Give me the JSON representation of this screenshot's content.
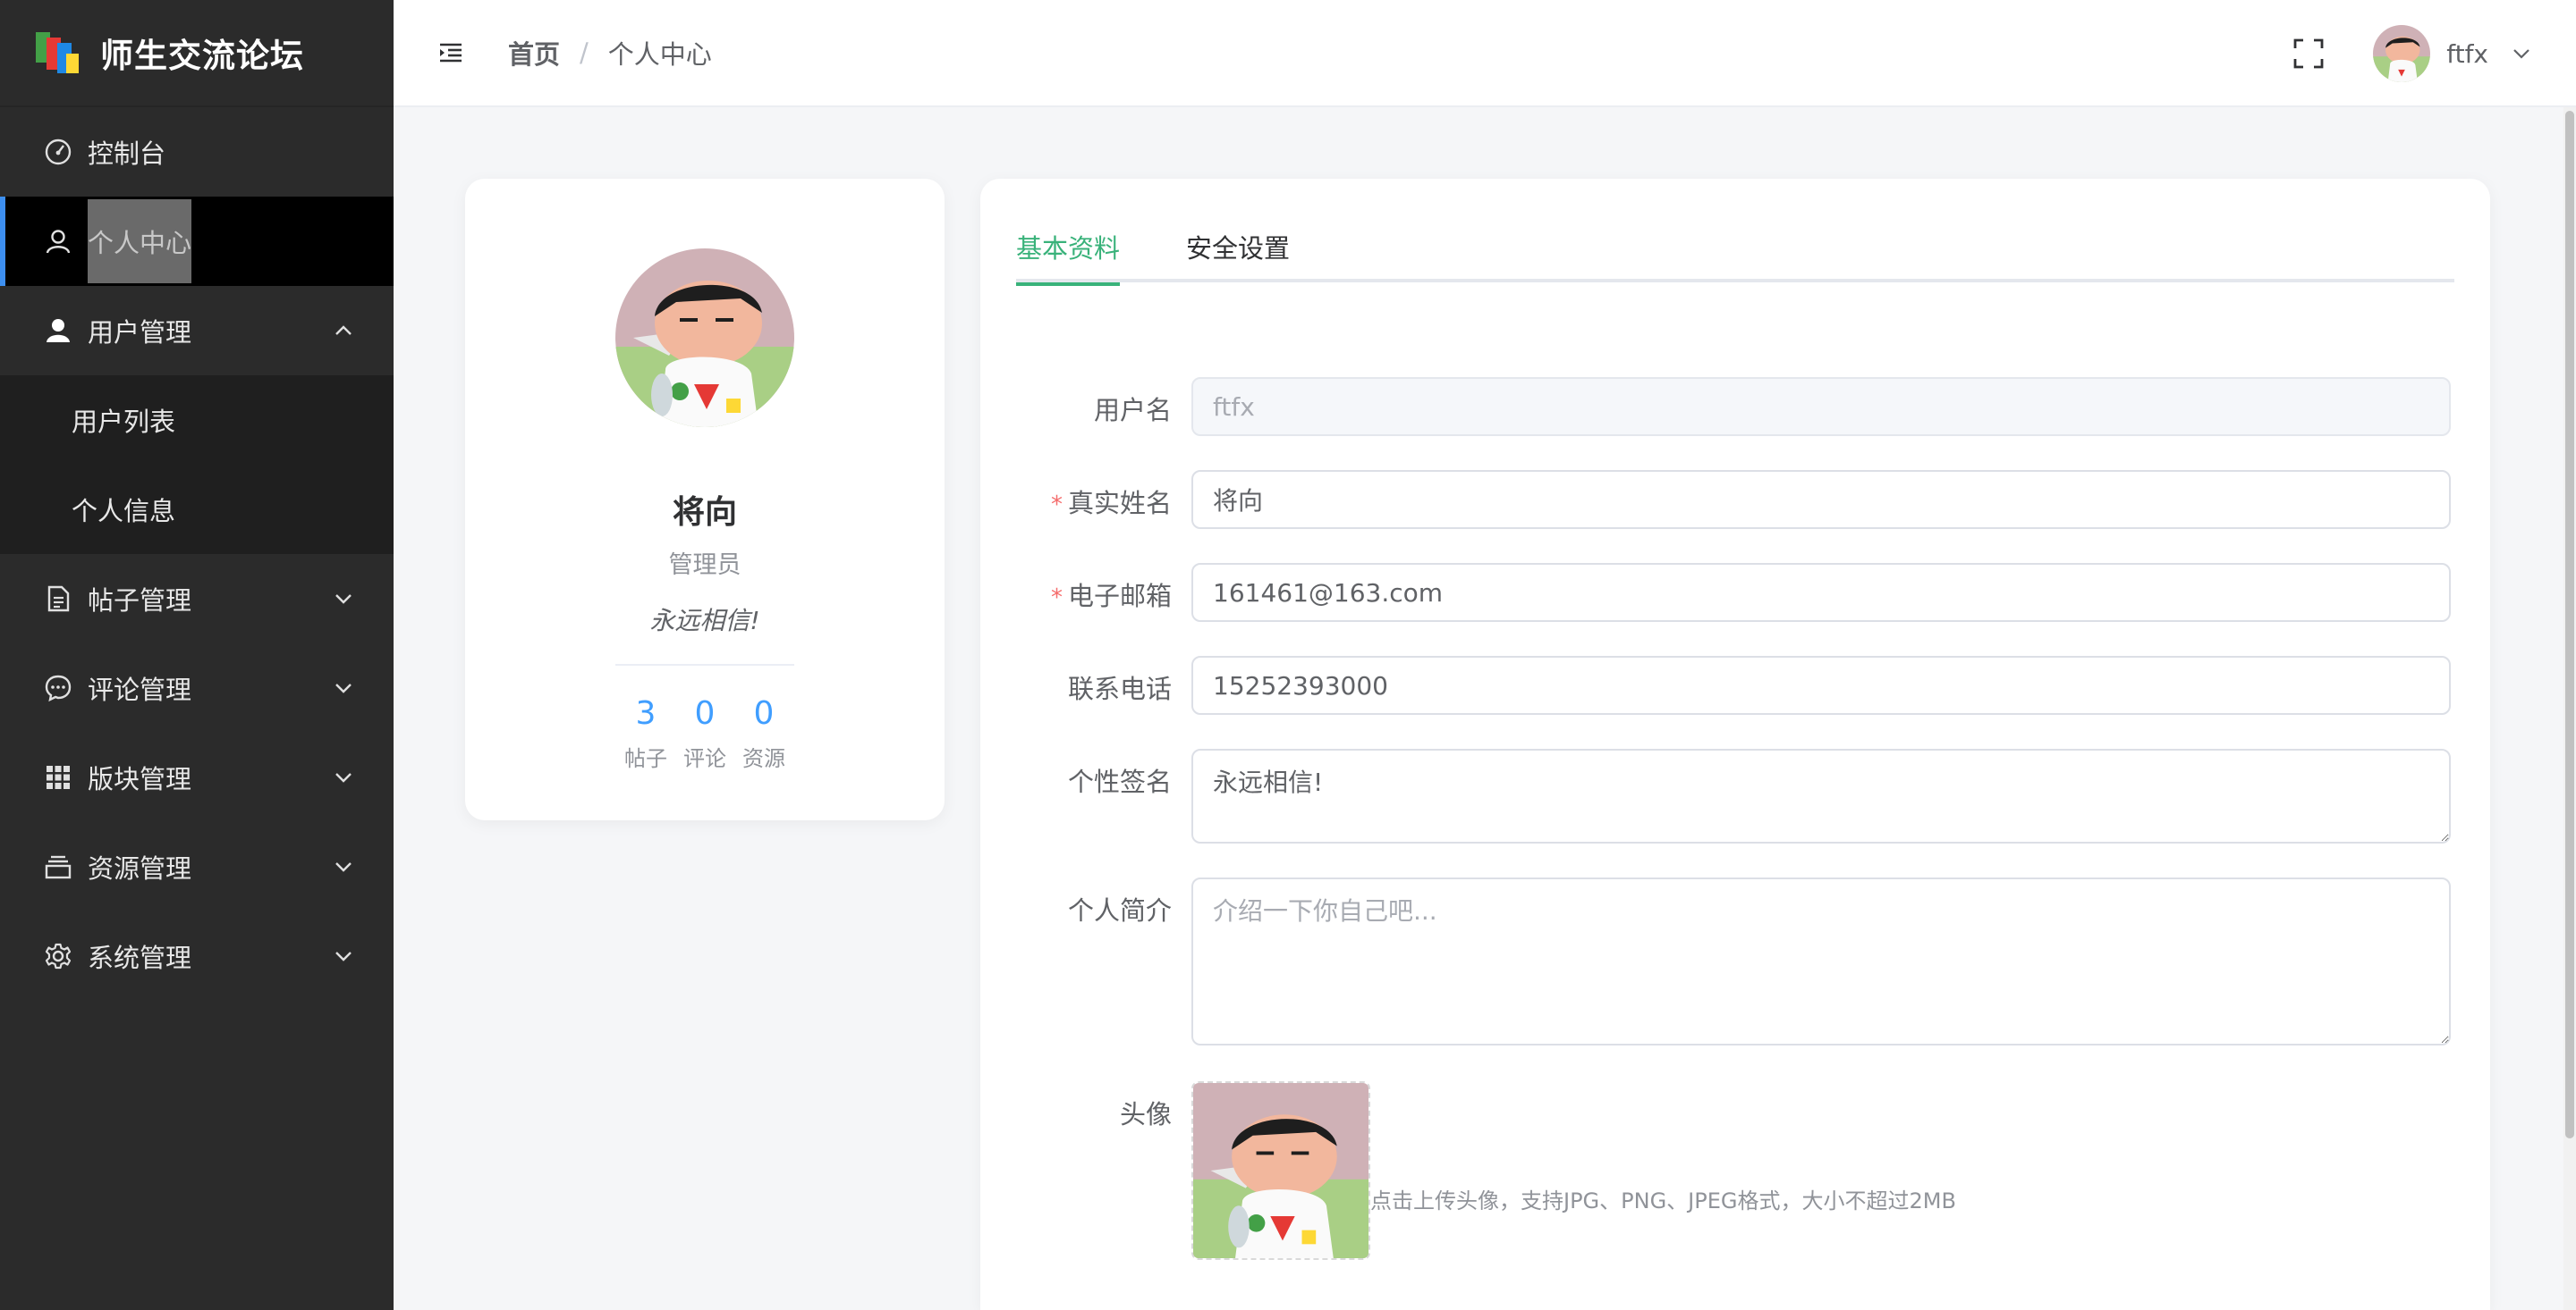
{
  "app": {
    "title": "师生交流论坛"
  },
  "colors": {
    "accent": "#39b27a",
    "link": "#409eff",
    "sidebar_bg": "#2b2b2b",
    "required": "#f56c6c"
  },
  "sidebar": {
    "items": [
      {
        "label": "控制台",
        "icon": "dashboard-icon"
      },
      {
        "label": "个人中心",
        "icon": "user-outline-icon",
        "active": true
      },
      {
        "label": "用户管理",
        "icon": "user-solid-icon",
        "expanded": true,
        "children": [
          {
            "label": "用户列表"
          },
          {
            "label": "个人信息"
          }
        ]
      },
      {
        "label": "帖子管理",
        "icon": "document-icon"
      },
      {
        "label": "评论管理",
        "icon": "chat-icon"
      },
      {
        "label": "版块管理",
        "icon": "grid-icon"
      },
      {
        "label": "资源管理",
        "icon": "folder-icon"
      },
      {
        "label": "系统管理",
        "icon": "gear-icon"
      }
    ]
  },
  "header": {
    "breadcrumb": {
      "home": "首页",
      "separator": "/",
      "current": "个人中心"
    },
    "username": "ftfx"
  },
  "profile": {
    "name": "将向",
    "role": "管理员",
    "signature": "永远相信!",
    "stats": [
      {
        "value": "3",
        "label": "帖子"
      },
      {
        "value": "0",
        "label": "评论"
      },
      {
        "value": "0",
        "label": "资源"
      }
    ]
  },
  "tabs": {
    "basic": "基本资料",
    "security": "安全设置"
  },
  "form": {
    "username": {
      "label": "用户名",
      "value": "ftfx"
    },
    "realname": {
      "label": "真实姓名",
      "value": "将向",
      "required": true
    },
    "email": {
      "label": "电子邮箱",
      "value": "161461@163.com",
      "required": true
    },
    "phone": {
      "label": "联系电话",
      "value": "15252393000"
    },
    "signature": {
      "label": "个性签名",
      "value": "永远相信!"
    },
    "bio": {
      "label": "个人简介",
      "placeholder": "介绍一下你自己吧..."
    },
    "avatar": {
      "label": "头像",
      "tip": "点击上传头像，支持JPG、PNG、JPEG格式，大小不超过2MB"
    },
    "required_mark": "*"
  }
}
